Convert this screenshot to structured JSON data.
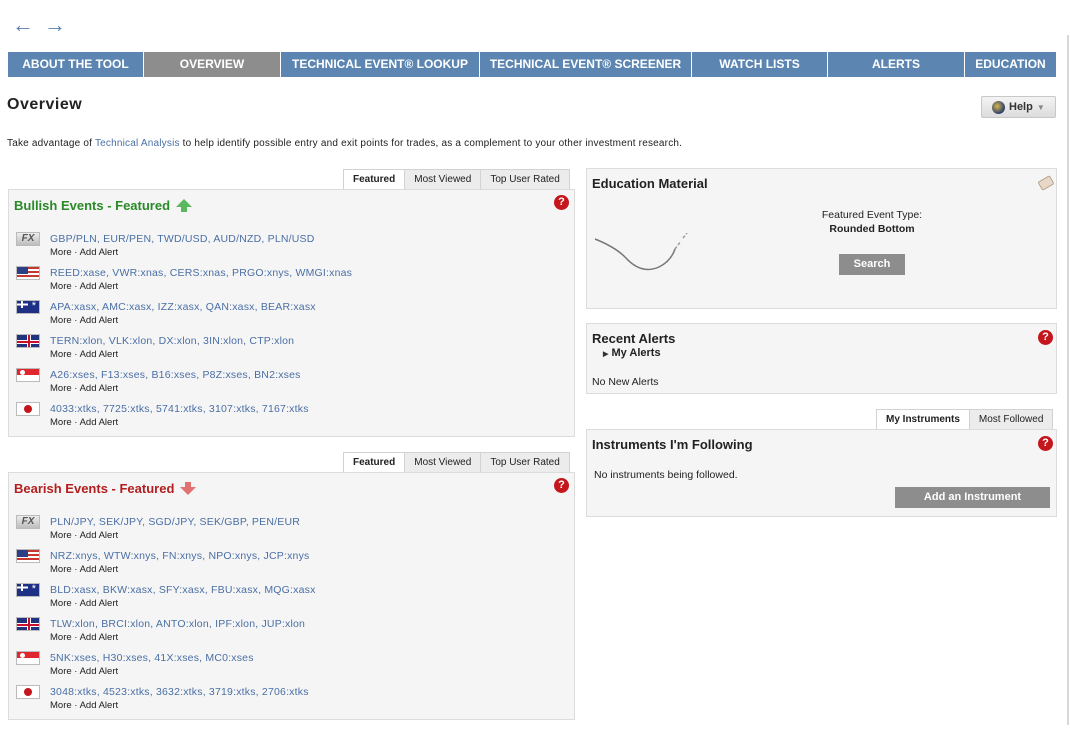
{
  "nav": {
    "back_icon": "arrow-left-icon",
    "forward_icon": "arrow-right-icon",
    "tabs": [
      {
        "label": "ABOUT THE TOOL",
        "active": false
      },
      {
        "label": "OVERVIEW",
        "active": true
      },
      {
        "label": "TECHNICAL EVENT® LOOKUP",
        "active": false
      },
      {
        "label": "TECHNICAL EVENT® SCREENER",
        "active": false
      },
      {
        "label": "WATCH LISTS",
        "active": false
      },
      {
        "label": "ALERTS",
        "active": false
      },
      {
        "label": "EDUCATION",
        "active": false
      }
    ]
  },
  "page": {
    "title": "Overview",
    "help_label": "Help",
    "intro_before": "Take advantage of ",
    "intro_link": "Technical Analysis",
    "intro_after": " to help identify possible entry and exit points for trades, as a complement to your other investment research."
  },
  "event_tabs": {
    "featured": "Featured",
    "most_viewed": "Most Viewed",
    "top_rated": "Top User Rated"
  },
  "row_actions": {
    "more": "More",
    "sep": " · ",
    "add_alert": "Add Alert"
  },
  "bullish": {
    "title": "Bullish Events - Featured",
    "rows": [
      {
        "flag": "fx",
        "flag_text": "FX",
        "tickers": "GBP/PLN, EUR/PEN, TWD/USD, AUD/NZD, PLN/USD"
      },
      {
        "flag": "us",
        "tickers": "REED:xase, VWR:xnas, CERS:xnas, PRGO:xnys, WMGI:xnas"
      },
      {
        "flag": "au",
        "tickers": "APA:xasx, AMC:xasx, IZZ:xasx, QAN:xasx, BEAR:xasx"
      },
      {
        "flag": "uk",
        "tickers": "TERN:xlon, VLK:xlon, DX:xlon, 3IN:xlon, CTP:xlon"
      },
      {
        "flag": "sg",
        "tickers": "A26:xses, F13:xses, B16:xses, P8Z:xses, BN2:xses"
      },
      {
        "flag": "jp",
        "tickers": "4033:xtks, 7725:xtks, 5741:xtks, 3107:xtks, 7167:xtks"
      }
    ]
  },
  "bearish": {
    "title": "Bearish Events - Featured",
    "rows": [
      {
        "flag": "fx",
        "flag_text": "FX",
        "tickers": "PLN/JPY, SEK/JPY, SGD/JPY, SEK/GBP, PEN/EUR"
      },
      {
        "flag": "us",
        "tickers": "NRZ:xnys, WTW:xnys, FN:xnys, NPO:xnys, JCP:xnys"
      },
      {
        "flag": "au",
        "tickers": "BLD:xasx, BKW:xasx, SFY:xasx, FBU:xasx, MQG:xasx"
      },
      {
        "flag": "uk",
        "tickers": "TLW:xlon, BRCI:xlon, ANTO:xlon, IPF:xlon, JUP:xlon"
      },
      {
        "flag": "sg",
        "tickers": "5NK:xses, H30:xses, 41X:xses, MC0:xses"
      },
      {
        "flag": "jp",
        "tickers": "3048:xtks, 4523:xtks, 3632:xtks, 3719:xtks, 2706:xtks"
      }
    ]
  },
  "education": {
    "title": "Education Material",
    "event_type_label": "Featured Event Type:",
    "event_type": "Rounded Bottom",
    "search_label": "Search"
  },
  "alerts": {
    "title": "Recent Alerts",
    "my_alerts": "My Alerts",
    "empty": "No New Alerts"
  },
  "instruments": {
    "tab_mine": "My Instruments",
    "tab_followed": "Most Followed",
    "title": "Instruments I'm Following",
    "empty": "No instruments being followed.",
    "add_label": "Add an Instrument"
  },
  "colors": {
    "nav_bg": "#5c86b1",
    "nav_active": "#8d8d8d",
    "bullish": "#2a8a28",
    "bearish": "#b21f1f",
    "link": "#4a6fa5"
  }
}
